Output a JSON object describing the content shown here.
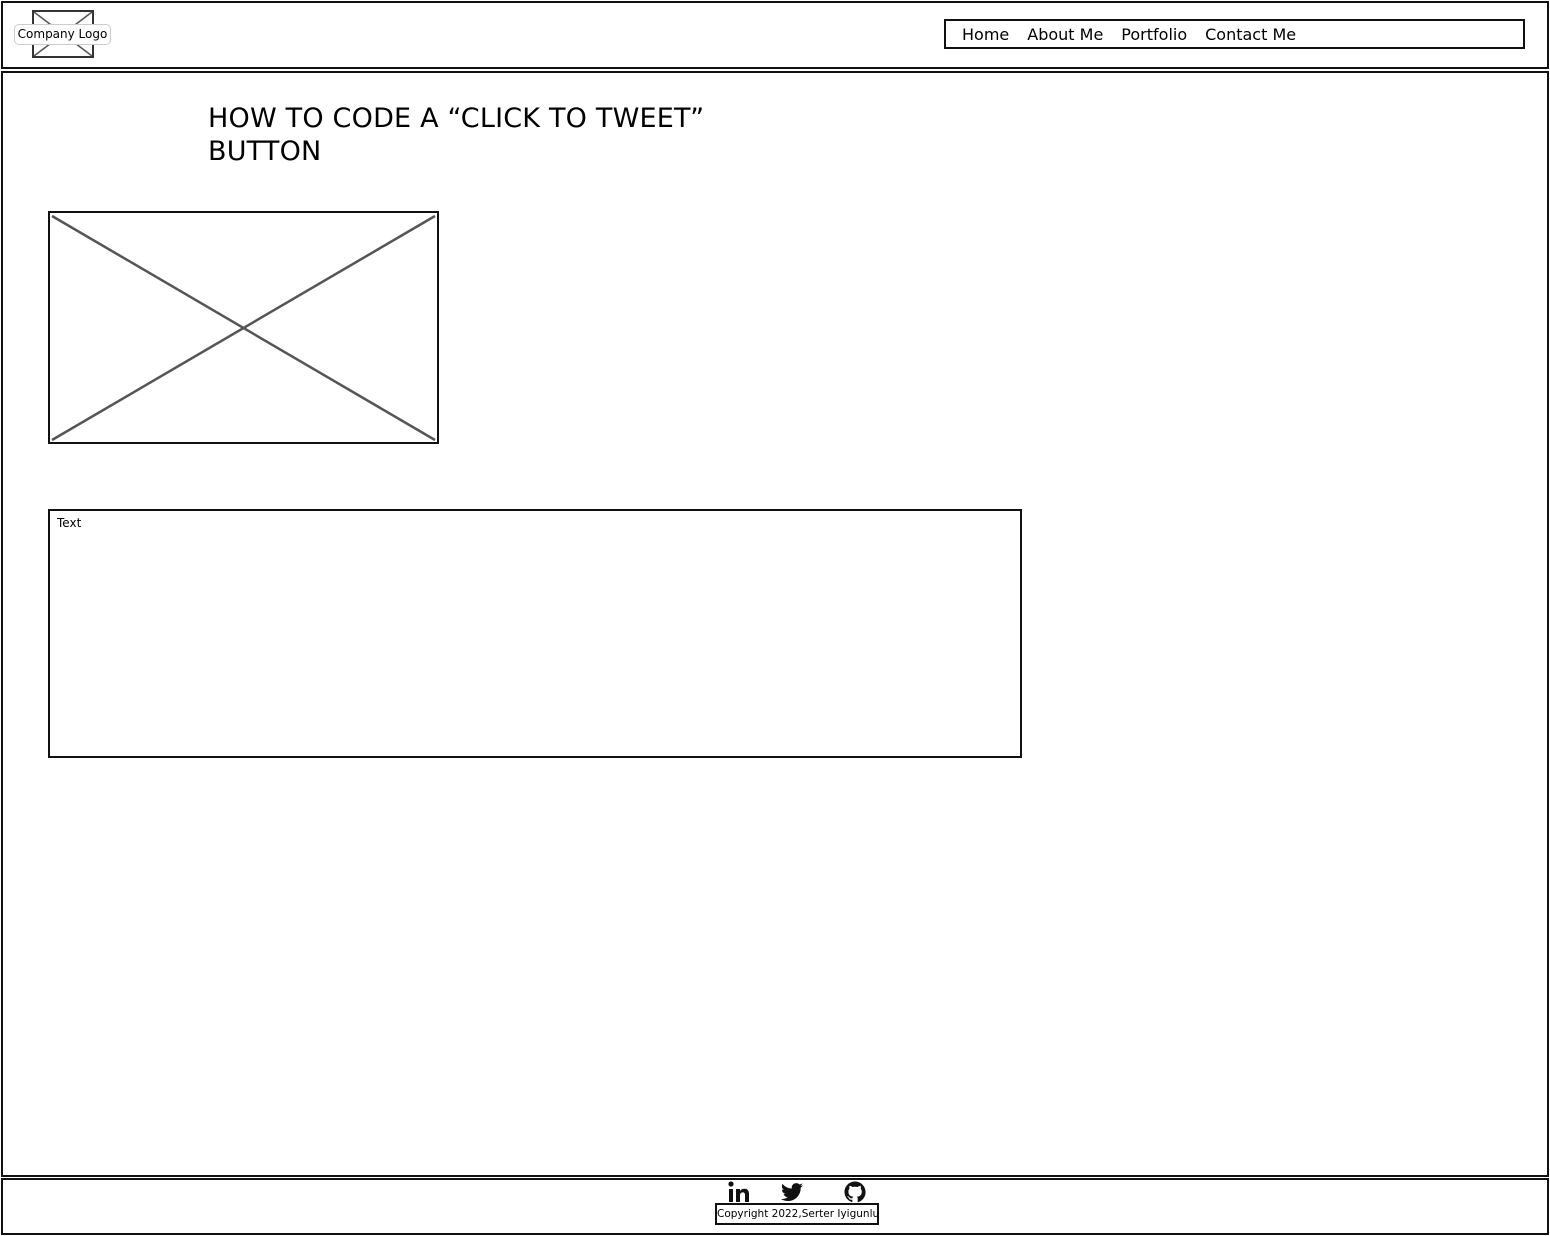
{
  "header": {
    "logo_label": "Company Logo",
    "nav": [
      "Home",
      "About Me",
      "Portfolio",
      "Contact Me"
    ]
  },
  "main": {
    "title_line1": "HOW TO CODE A “CLICK TO TWEET”",
    "title_line2": "BUTTON",
    "text_label": "Text"
  },
  "footer": {
    "social_icons": [
      "linkedin-icon",
      "twitter-icon",
      "github-icon"
    ],
    "copyright": "Copyright 2022,Serter Iyigunlu"
  }
}
